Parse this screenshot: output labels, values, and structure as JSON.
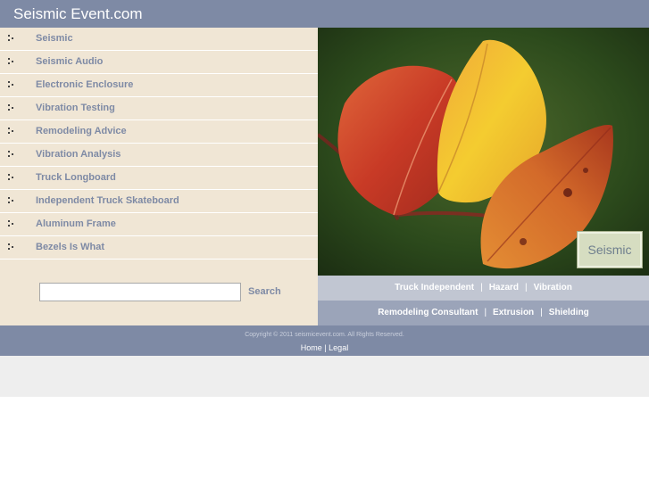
{
  "site": {
    "title": "Seismic Event.com"
  },
  "nav": {
    "items": [
      {
        "label": "Seismic"
      },
      {
        "label": "Seismic Audio"
      },
      {
        "label": "Electronic Enclosure"
      },
      {
        "label": "Vibration Testing"
      },
      {
        "label": "Remodeling Advice"
      },
      {
        "label": "Vibration Analysis"
      },
      {
        "label": "Truck Longboard"
      },
      {
        "label": "Independent Truck Skateboard"
      },
      {
        "label": "Aluminum Frame"
      },
      {
        "label": "Bezels Is What"
      }
    ]
  },
  "search": {
    "value": "",
    "button_label": "Search"
  },
  "photo": {
    "badge_label": "Seismic"
  },
  "links_top": [
    "Truck Independent",
    "Hazard",
    "Vibration"
  ],
  "links_bottom": [
    "Remodeling Consultant",
    "Extrusion",
    "Shielding"
  ],
  "separator": "|",
  "footer": {
    "copyright": "Copyright © 2011 seismicevent.com. All Rights Reserved.",
    "home_label": "Home",
    "legal_label": "Legal"
  },
  "colors": {
    "header_bg": "#7e8aa5",
    "sidebar_bg": "#f0e6d5",
    "nav_text": "#7e8aa5",
    "links_top_bg": "#c1c6d2",
    "links_bottom_bg": "#9ba4b9"
  }
}
